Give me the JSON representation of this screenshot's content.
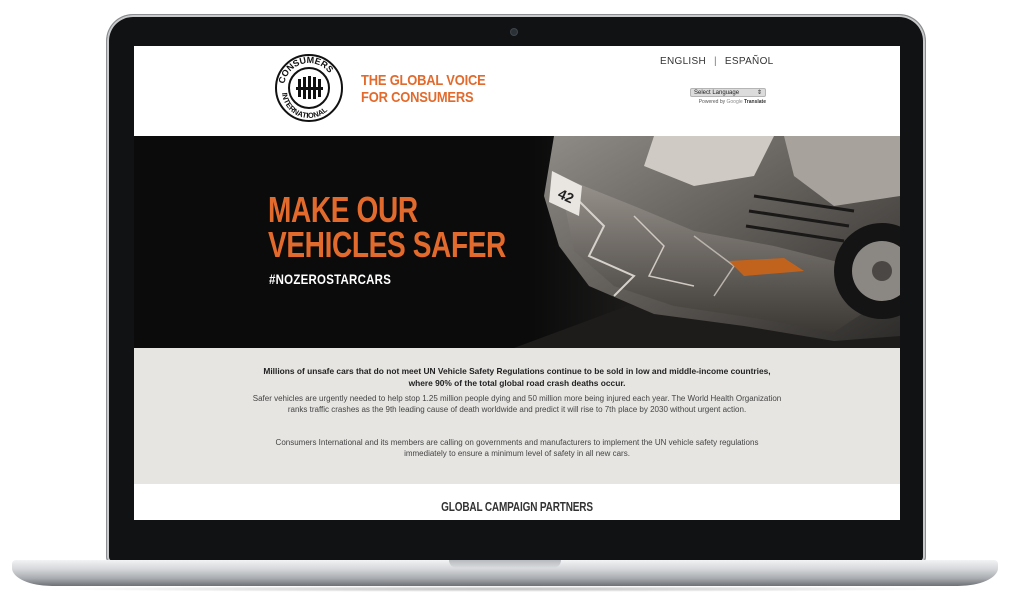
{
  "header": {
    "logo_alt": "CONSUMERS INTERNATIONAL",
    "tagline_line1": "THE GLOBAL VOICE",
    "tagline_line2": "FOR CONSUMERS"
  },
  "language": {
    "english": "ENGLISH",
    "separator": "|",
    "spanish": "ESPAÑOL",
    "select_value": "Select Language",
    "select_arrow": "⇕",
    "powered_prefix": "Powered by",
    "powered_google": "Google",
    "powered_suffix": "Translate"
  },
  "hero": {
    "title_line1": "MAKE OUR",
    "title_line2": "VEHICLES SAFER",
    "hashtag": "#NOZEROSTARCARS"
  },
  "info": {
    "lead": "Millions of unsafe cars that do not meet UN Vehicle Safety Regulations continue to be sold in low and middle-income countries, where 90% of the total global road crash deaths occur.",
    "paragraph1": "Safer vehicles are urgently needed to help stop 1.25 million people dying and 50 million more being injured each year. The World Health Organization ranks traffic crashes as the 9th leading cause of death worldwide and predict it will rise to 7th place by 2030 without urgent action.",
    "paragraph2": "Consumers International and its members are calling on governments and manufacturers to implement the UN vehicle safety regulations immediately to ensure a minimum level of safety in all new cars."
  },
  "partners": {
    "heading": "GLOBAL CAMPAIGN PARTNERS"
  },
  "colors": {
    "accent": "#e26a2c",
    "hero_bg": "#0b0b0b",
    "info_bg": "#e6e5e2"
  }
}
